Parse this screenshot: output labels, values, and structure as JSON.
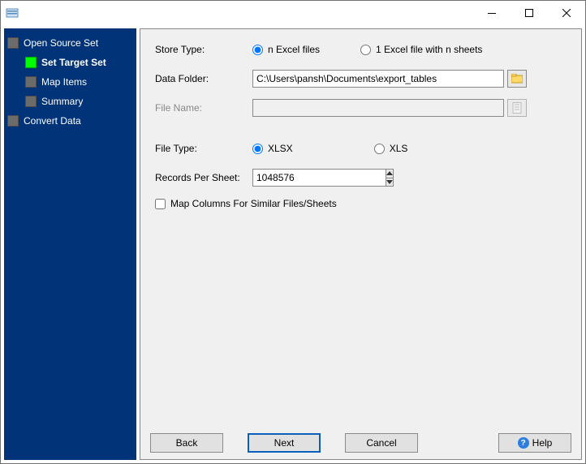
{
  "nav": {
    "items": [
      {
        "label": "Open Source Set",
        "level": 1
      },
      {
        "label": "Set Target Set",
        "level": 2,
        "active": true
      },
      {
        "label": "Map Items",
        "level": 2
      },
      {
        "label": "Summary",
        "level": 2
      },
      {
        "label": "Convert Data",
        "level": 1
      }
    ]
  },
  "form": {
    "storeType": {
      "label": "Store Type:",
      "options": [
        {
          "label": "n Excel files",
          "selected": true
        },
        {
          "label": "1 Excel file with n sheets",
          "selected": false
        }
      ]
    },
    "dataFolder": {
      "label": "Data Folder:",
      "value": "C:\\Users\\pansh\\Documents\\export_tables"
    },
    "fileName": {
      "label": "File Name:",
      "value": ""
    },
    "fileType": {
      "label": "File Type:",
      "options": [
        {
          "label": "XLSX",
          "selected": true
        },
        {
          "label": "XLS",
          "selected": false
        }
      ]
    },
    "recordsPerSheet": {
      "label": "Records Per Sheet:",
      "value": "1048576"
    },
    "mapColumns": {
      "label": "Map Columns For Similar Files/Sheets",
      "checked": false
    }
  },
  "buttons": {
    "back": "Back",
    "next": "Next",
    "cancel": "Cancel",
    "help": "Help"
  }
}
